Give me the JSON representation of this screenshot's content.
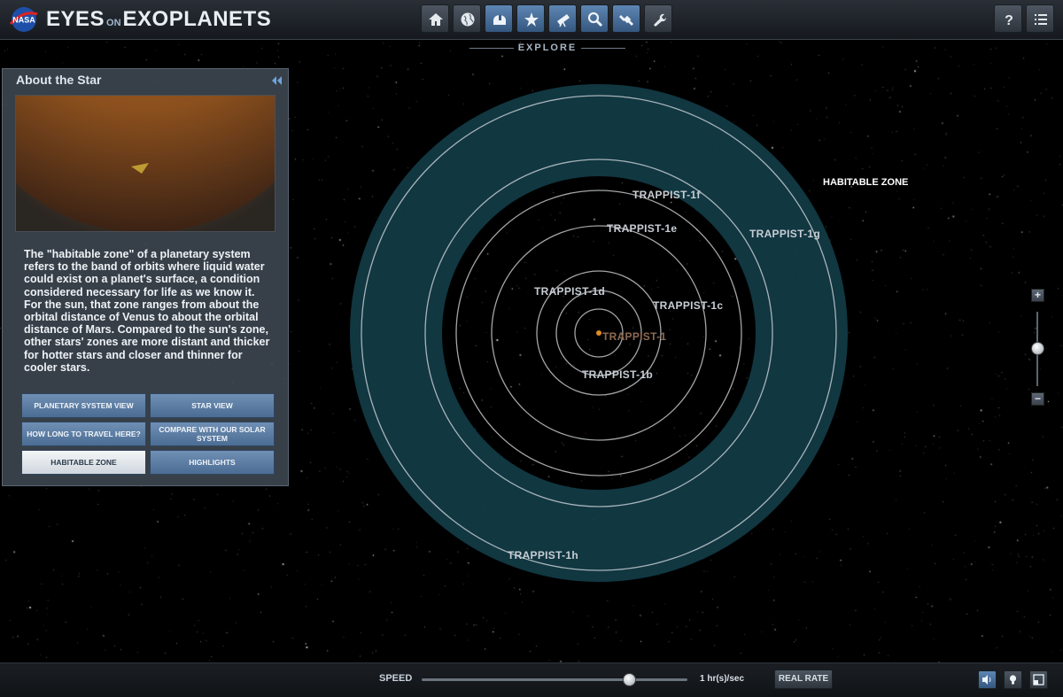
{
  "app": {
    "title_part1": "EYES",
    "title_on": "ON",
    "title_part2": "EXOPLANETS",
    "logo_text": "NASA"
  },
  "nav": {
    "section_label": "EXPLORE",
    "buttons": [
      {
        "name": "home-icon",
        "active": false
      },
      {
        "name": "globe-icon",
        "active": false
      },
      {
        "name": "observatory-icon",
        "active": true
      },
      {
        "name": "star-burst-icon",
        "active": true
      },
      {
        "name": "telescope-icon",
        "active": true
      },
      {
        "name": "magnifier-icon",
        "active": true
      },
      {
        "name": "satellite-icon",
        "active": true
      },
      {
        "name": "wrench-icon",
        "active": false
      }
    ],
    "help_icon": "question-icon",
    "menu_icon": "list-icon"
  },
  "panel": {
    "title": "About the Star",
    "collapse_icon": "double-chevron-left-icon",
    "description": "The \"habitable zone\" of a planetary system refers to the band of orbits where liquid water could exist on a planet's surface, a condition considered necessary for life as we know it.  For the sun, that zone ranges from about the orbital distance of Venus to about the orbital distance of Mars. Compared to the sun's zone, other stars' zones are more distant and thicker for hotter stars and closer and thinner for cooler stars.",
    "buttons": [
      {
        "label": "PLANETARY SYSTEM VIEW",
        "active": false
      },
      {
        "label": "STAR VIEW",
        "active": false
      },
      {
        "label": "HOW LONG TO TRAVEL HERE?",
        "active": false
      },
      {
        "label": "COMPARE WITH OUR SOLAR SYSTEM",
        "active": false
      },
      {
        "label": "HABITABLE ZONE",
        "active": true
      },
      {
        "label": "HIGHLIGHTS",
        "active": false
      }
    ]
  },
  "orbit_view": {
    "habitable_zone_label": "HABITABLE ZONE",
    "star_label": "TRAPPIST-1",
    "planets": [
      "TRAPPIST-1b",
      "TRAPPIST-1c",
      "TRAPPIST-1d",
      "TRAPPIST-1e",
      "TRAPPIST-1f",
      "TRAPPIST-1g",
      "TRAPPIST-1h"
    ],
    "habitable_zone_color": "#123a44",
    "orbit_color": "#d9dde2"
  },
  "zoom": {
    "plus": "+",
    "minus": "−"
  },
  "bottom": {
    "speed_label": "SPEED",
    "speed_value": "1 hr(s)/sec",
    "real_rate_label": "REAL RATE",
    "icons": [
      "speaker-icon",
      "lightbulb-icon",
      "fullscreen-icon"
    ]
  }
}
